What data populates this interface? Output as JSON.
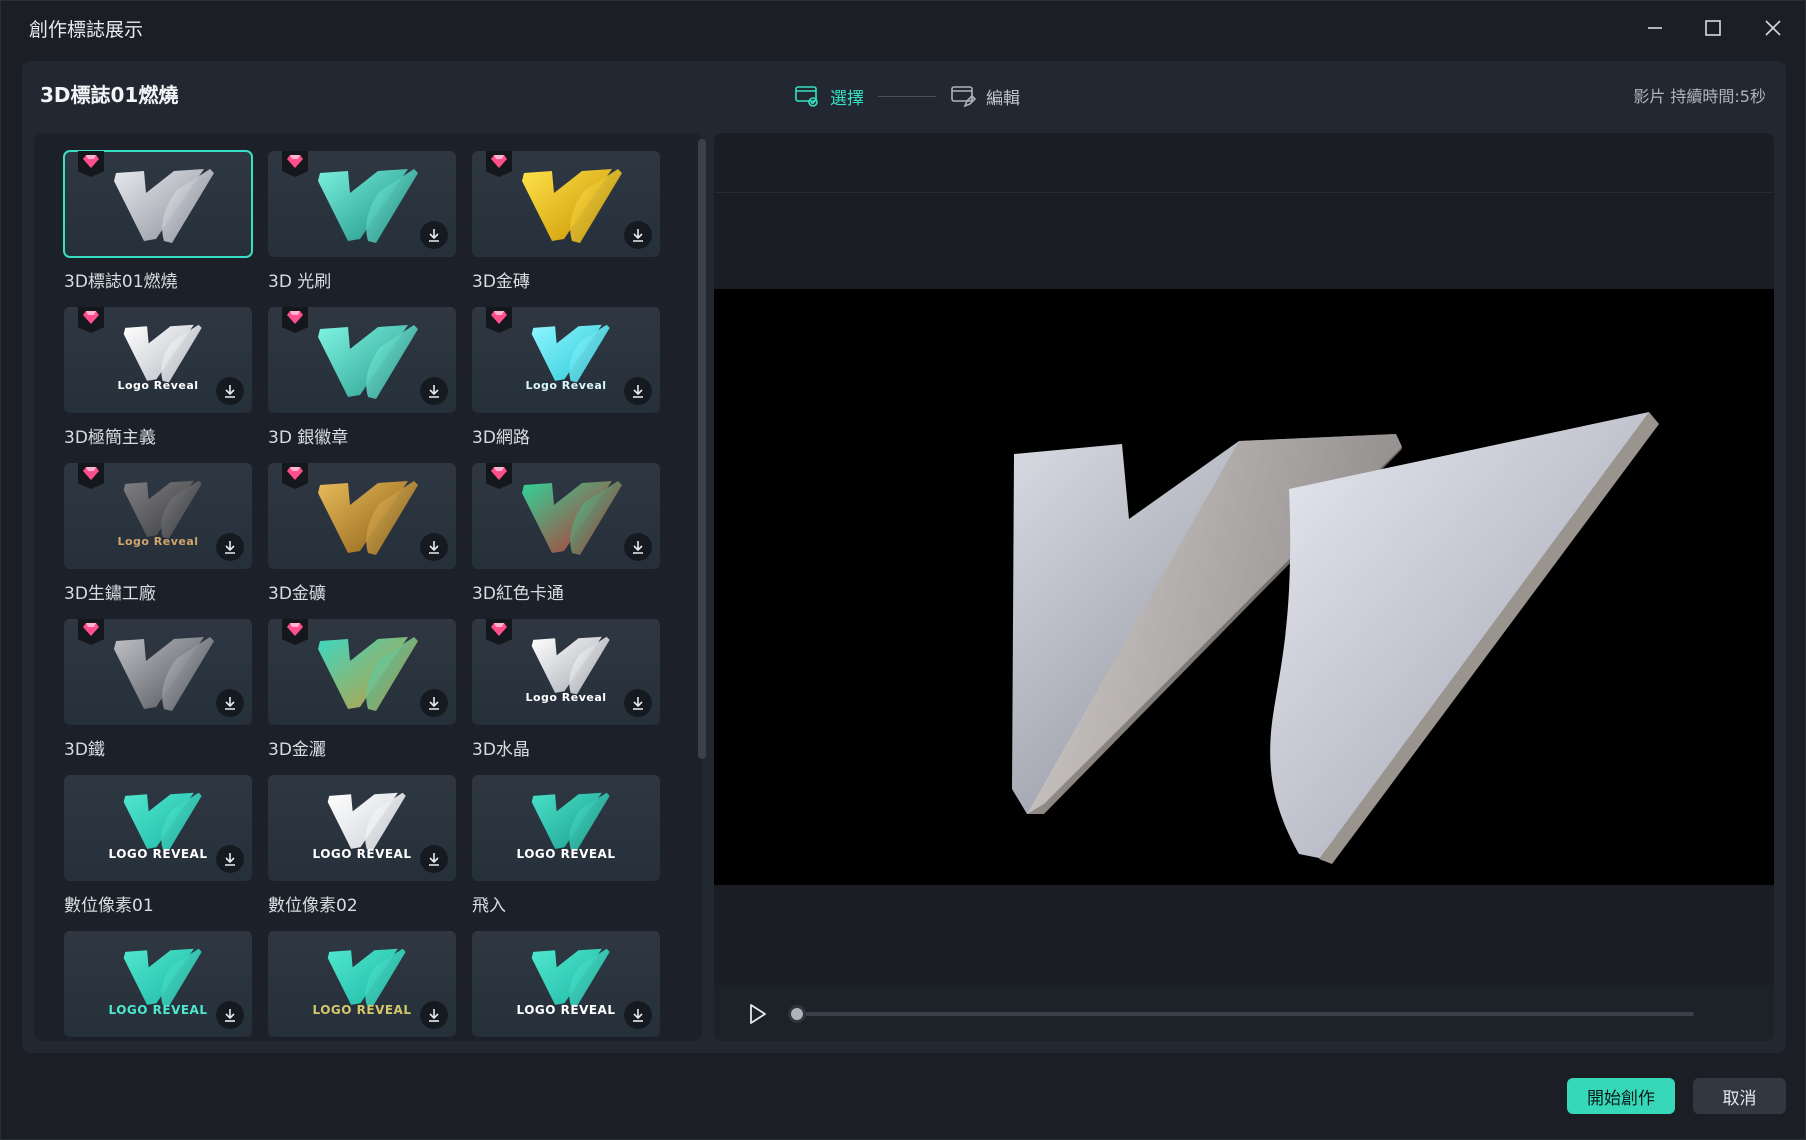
{
  "window": {
    "title": "創作標誌展示",
    "minimize_label": "minimize",
    "maximize_label": "maximize",
    "close_label": "close"
  },
  "header": {
    "template_title": "3D標誌01燃燒",
    "steps": [
      {
        "label": "選擇",
        "icon": "select-step-icon",
        "active": true
      },
      {
        "label": "編輯",
        "icon": "edit-step-icon",
        "active": false
      }
    ],
    "duration": "影片 持續時間:5秒"
  },
  "templates": [
    {
      "label": "3D標誌01燃燒",
      "premium": true,
      "download": false,
      "selected": true,
      "style": "silver"
    },
    {
      "label": "3D 光刷",
      "premium": true,
      "download": true,
      "selected": false,
      "style": "teal"
    },
    {
      "label": "3D金磚",
      "premium": true,
      "download": true,
      "selected": false,
      "style": "gold-bricks"
    },
    {
      "label": "3D極簡主義",
      "premium": true,
      "download": true,
      "selected": false,
      "style": "white",
      "text": "Logo Reveal"
    },
    {
      "label": "3D 銀徽章",
      "premium": true,
      "download": true,
      "selected": false,
      "style": "teal-silver"
    },
    {
      "label": "3D網路",
      "premium": true,
      "download": true,
      "selected": false,
      "style": "cyan",
      "text": "Logo Reveal"
    },
    {
      "label": "3D生鏽工廠",
      "premium": true,
      "download": true,
      "selected": false,
      "style": "rust",
      "text": "Logo Reveal"
    },
    {
      "label": "3D金礦",
      "premium": true,
      "download": true,
      "selected": false,
      "style": "gold"
    },
    {
      "label": "3D紅色卡通",
      "premium": true,
      "download": true,
      "selected": false,
      "style": "green-red"
    },
    {
      "label": "3D鐵",
      "premium": true,
      "download": true,
      "selected": false,
      "style": "iron"
    },
    {
      "label": "3D金灑",
      "premium": true,
      "download": true,
      "selected": false,
      "style": "teal-gold"
    },
    {
      "label": "3D水晶",
      "premium": true,
      "download": true,
      "selected": false,
      "style": "crystal",
      "text": "Logo Reveal"
    },
    {
      "label": "數位像素01",
      "premium": false,
      "download": true,
      "selected": false,
      "style": "flat-teal",
      "text": "LOGO REVEAL"
    },
    {
      "label": "數位像素02",
      "premium": false,
      "download": true,
      "selected": false,
      "style": "flat-white",
      "text": "LOGO REVEAL"
    },
    {
      "label": "飛入",
      "premium": false,
      "download": false,
      "selected": false,
      "style": "flat-teal-big",
      "text": "LOGO REVEAL"
    },
    {
      "label": "",
      "premium": false,
      "download": true,
      "selected": false,
      "style": "flat-teal-round",
      "text": "LOGO REVEAL"
    },
    {
      "label": "",
      "premium": false,
      "download": true,
      "selected": false,
      "style": "flat-teal-thin",
      "text": "LOGO REVEAL"
    },
    {
      "label": "",
      "premium": false,
      "download": true,
      "selected": false,
      "style": "flat-teal-bold",
      "text": "LOGO REVEAL"
    }
  ],
  "player": {
    "progress": 0
  },
  "footer": {
    "start_label": "開始創作",
    "cancel_label": "取消"
  },
  "colors": {
    "accent": "#37e0c2",
    "gem": "#ff4f8b",
    "primary_button": "#37d8ba"
  }
}
